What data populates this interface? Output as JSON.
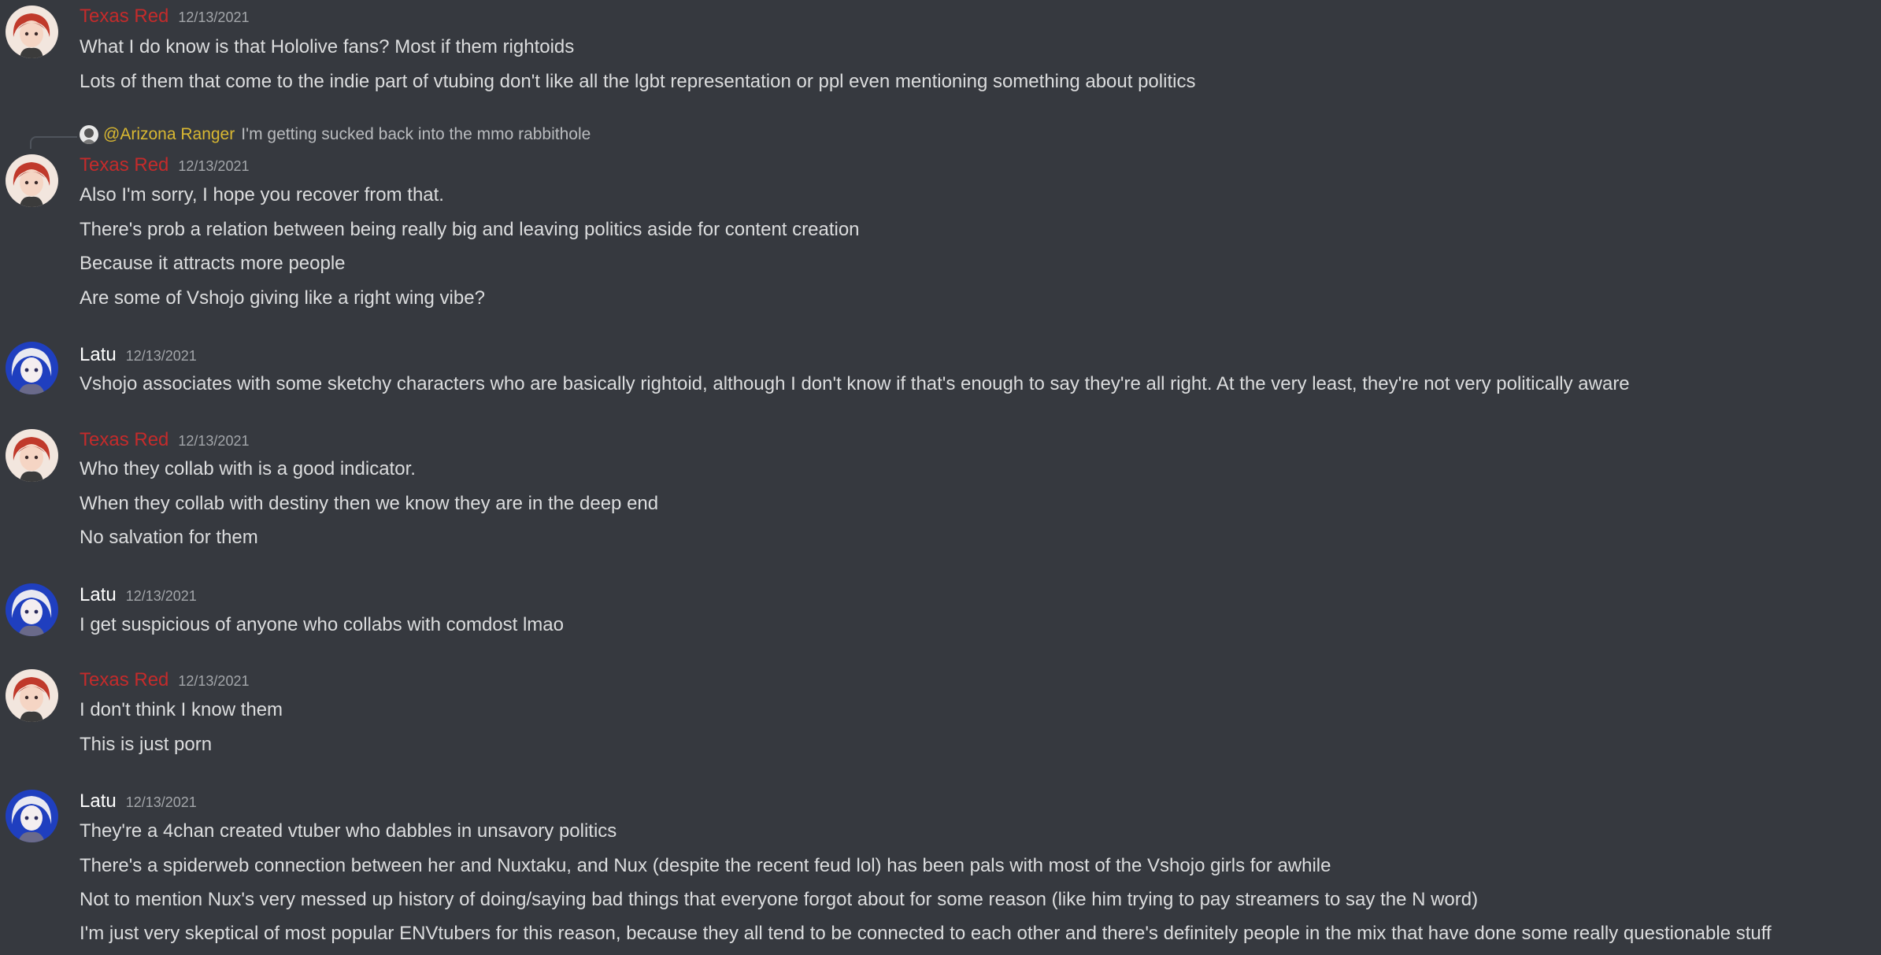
{
  "colors": {
    "background": "#36393f",
    "texas_red_name": "#c42b2b",
    "latu_name": "#ffffff",
    "message_text": "#dcddde",
    "timestamp": "#a3a6aa",
    "reply_mention": "#d9b832"
  },
  "messages": [
    {
      "author": "Texas Red",
      "timestamp": "12/13/2021",
      "avatar_icon": "red-haired-avatar-icon",
      "lines": [
        "What I do know is that Hololive fans? Most if them rightoids",
        "Lots of them that come to the indie part of vtubing don't like all the lgbt representation or  ppl even mentioning something about politics"
      ]
    },
    {
      "reply": {
        "mention": "@Arizona Ranger",
        "text": "I'm getting sucked back into the mmo rabbithole",
        "avatar_icon": "ranger-avatar-icon"
      },
      "author": "Texas Red",
      "timestamp": "12/13/2021",
      "avatar_icon": "red-haired-avatar-icon",
      "lines": [
        "Also I'm sorry, I hope you recover from that.",
        "There's prob a relation between being really big and leaving politics aside for content creation",
        "Because it attracts more people",
        "Are some of Vshojo giving like a right wing vibe?"
      ]
    },
    {
      "author": "Latu",
      "timestamp": "12/13/2021",
      "avatar_icon": "latu-avatar-icon",
      "lines": [
        "Vshojo associates with some sketchy characters who are basically rightoid, although I don't know if that's enough to say they're all right. At the very least, they're not very politically aware"
      ]
    },
    {
      "author": "Texas Red",
      "timestamp": "12/13/2021",
      "avatar_icon": "red-haired-avatar-icon",
      "lines": [
        "Who they collab with is a good indicator.",
        "When they collab with destiny then we know they are in the deep end",
        "No salvation for them"
      ]
    },
    {
      "author": "Latu",
      "timestamp": "12/13/2021",
      "avatar_icon": "latu-avatar-icon",
      "lines": [
        "I get suspicious of anyone who collabs with comdost lmao"
      ]
    },
    {
      "author": "Texas Red",
      "timestamp": "12/13/2021",
      "avatar_icon": "red-haired-avatar-icon",
      "lines": [
        "I don't think I know them",
        "This is just porn"
      ]
    },
    {
      "author": "Latu",
      "timestamp": "12/13/2021",
      "avatar_icon": "latu-avatar-icon",
      "lines": [
        "They're a 4chan created vtuber who dabbles in unsavory politics",
        "There's a spiderweb connection between her and Nuxtaku, and Nux (despite the recent feud lol) has been pals with most of the Vshojo girls for awhile",
        "Not to mention Nux's very messed up history of doing/saying bad things that everyone forgot about for some reason (like him trying to pay streamers to say the N word)",
        "I'm just very skeptical of most popular ENVtubers for this reason, because they all tend to be connected to each other and there's definitely people in the mix that have done some really questionable stuff"
      ]
    }
  ]
}
